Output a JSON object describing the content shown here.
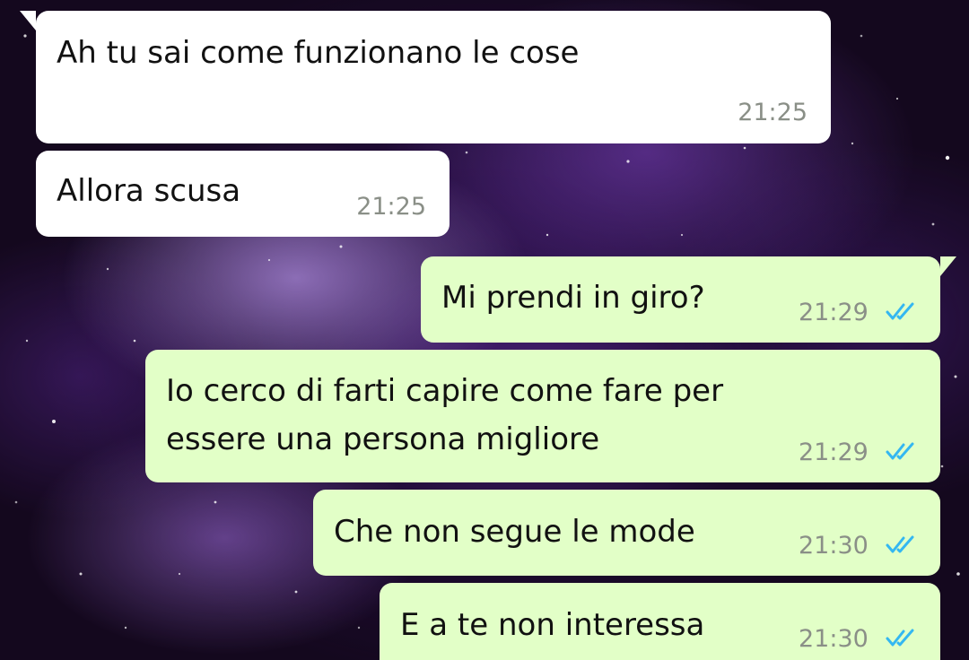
{
  "colors": {
    "incoming_bubble": "#ffffff",
    "outgoing_bubble": "#e2ffc7",
    "timestamp": "#8a8f87",
    "read_ticks": "#34b7f1",
    "text": "#111111"
  },
  "messages": [
    {
      "direction": "incoming",
      "lines": [
        "Ah tu sai come funzionano le cose"
      ],
      "time": "21:25"
    },
    {
      "direction": "incoming",
      "lines": [
        "Allora scusa"
      ],
      "time": "21:25"
    },
    {
      "direction": "outgoing",
      "lines": [
        "Mi prendi in giro?"
      ],
      "time": "21:29",
      "status_icon": "double-check-read-icon"
    },
    {
      "direction": "outgoing",
      "lines": [
        "Io cerco di farti capire come fare per",
        "essere una persona migliore"
      ],
      "time": "21:29",
      "status_icon": "double-check-read-icon"
    },
    {
      "direction": "outgoing",
      "lines": [
        "Che non segue le mode"
      ],
      "time": "21:30",
      "status_icon": "double-check-read-icon"
    },
    {
      "direction": "outgoing",
      "lines": [
        "E a te non interessa"
      ],
      "time": "21:30",
      "status_icon": "double-check-read-icon"
    }
  ]
}
